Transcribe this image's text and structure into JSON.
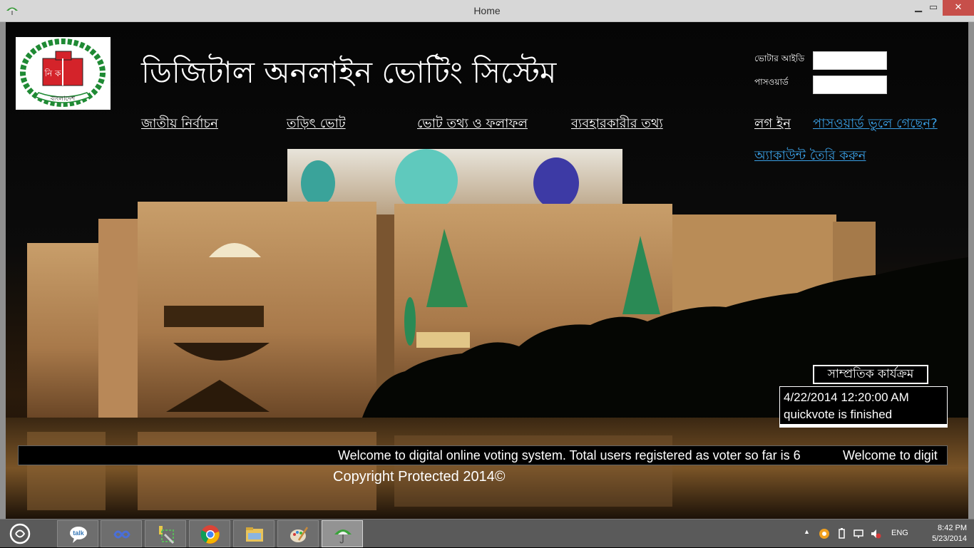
{
  "window": {
    "title": "Home",
    "min_glyph": "▁",
    "max_glyph": "▭",
    "close_glyph": "✕"
  },
  "logo": {
    "top_letters": "নি ক",
    "ribbon_text": "বাংলাদেশ"
  },
  "site": {
    "title": "ডিজিটাল অনলাইন ভোটিং সিস্টেম"
  },
  "nav": {
    "items": [
      {
        "label": "জাতীয় নির্বাচন"
      },
      {
        "label": "তড়িৎ ভোট"
      },
      {
        "label": "ভোট তথ্য ও ফলাফল"
      },
      {
        "label": "ব্যবহারকারীর তথ্য"
      }
    ]
  },
  "login": {
    "voter_id_label": "ভোটার আইডি",
    "voter_id_value": "",
    "password_label": "পাসওয়ার্ড",
    "password_value": "",
    "login_link": "লগ ইন",
    "forgot_link": "পাসওয়ার্ড ভুলে গেছেন?",
    "create_account_link": "অ্যাকাউন্ট তৈরি করুন"
  },
  "recent": {
    "title": "সাম্প্রতিক কার্যক্রম",
    "entries": [
      "4/22/2014 12:20:00 AM",
      "quickvote is finished"
    ]
  },
  "marquee": {
    "text1": "Welcome to digital online voting system. Total users registered as voter so far is 6",
    "text2": "Welcome to digit"
  },
  "footer": {
    "copyright": "Copyright Protected 2014©"
  },
  "taskbar": {
    "apps": [
      "talk-icon",
      "infinity-icon",
      "tools-icon",
      "chrome-icon",
      "file-explorer-icon",
      "paint-icon",
      "umbrella-app-icon"
    ],
    "talk_label": "talk",
    "lang": "ENG",
    "time": "8:42 PM",
    "date": "5/23/2014"
  },
  "colors": {
    "link_blue": "#3aa0e6",
    "close_red": "#c74f4a",
    "taskbar": "#5a5a5a"
  }
}
